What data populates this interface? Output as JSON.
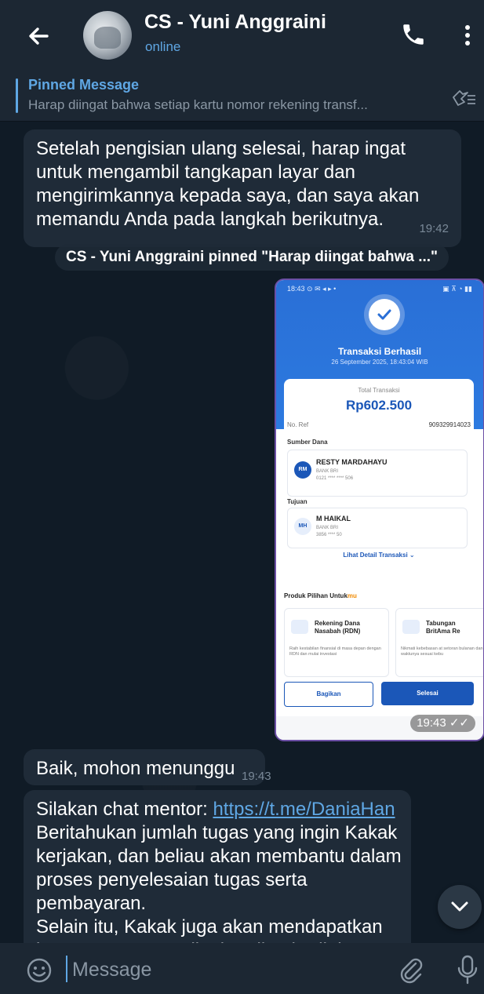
{
  "header": {
    "title": "CS - Yuni Anggraini",
    "status": "online"
  },
  "pinned": {
    "label": "Pinned Message",
    "text": "Harap diingat bahwa setiap kartu nomor rekening transf..."
  },
  "messages": {
    "m1": {
      "text": "Setelah pengisian ulang selesai, harap ingat untuk mengambil tangkapan layar dan mengirimkannya kepada saya, dan saya akan memandu Anda pada langkah berikutnya.",
      "time": "19:42"
    },
    "service": "CS - Yuni Anggraini pinned \"Harap diingat bahwa ...\"",
    "photo": {
      "time": "19:43",
      "receipt": {
        "title": "Transaksi Berhasil",
        "date": "26 September 2025, 18:43:04 WIB",
        "total_label": "Total Transaksi",
        "total": "Rp602.500",
        "ref_label": "No. Ref",
        "ref_value": "909329914023",
        "source_label": "Sumber Dana",
        "source_initials": "RM",
        "source_name": "RESTY MARDAHAYU",
        "source_bank": "BANK BRI",
        "source_account": "0121 **** **** 506",
        "dest_label": "Tujuan",
        "dest_initials": "MH",
        "dest_name": "M HAIKAL",
        "dest_bank": "BANK BRI",
        "dest_account": "3856 **** 50",
        "detail_link": "Lihat Detail Transaksi ⌄",
        "products_label": "Produk Pilihan Untuk",
        "products_label_accent": "mu",
        "product1_name": "Rekening Dana Nasabah (RDN)",
        "product1_desc": "Raih kestabilan finansial di masa depan dengan RDN dan mulai investasi",
        "product2_name": "Tabungan BritAma Re",
        "product2_desc": "Nikmati kebebasan at setoran bulanan dan j waktunya sesuai kebu",
        "share_label": "Bagikan",
        "done_label": "Selesai"
      }
    },
    "m2": {
      "text": "Baik, mohon menunggu",
      "time": "19:43"
    },
    "m3": {
      "prefix": "Silakan chat mentor: ",
      "link": "https://t.me/DaniaHan",
      "rest": "Beritahukan jumlah tugas yang ingin Kakak kerjakan, dan beliau akan membantu dalam proses penyelesaian tugas serta pembayaran.",
      "rest2": "Selain itu, Kakak juga akan mendapatkan kesempatan mengikuti undian hadiah"
    }
  },
  "input": {
    "placeholder": "Message"
  },
  "colors": {
    "accent": "#5fa7e4",
    "bubble": "#1f2b38",
    "bar": "#1c2733"
  },
  "icons": [
    "arrow-left-icon",
    "phone-icon",
    "more-vert-icon",
    "unpin-icon",
    "chevron-down-icon",
    "emoji-icon",
    "paperclip-icon",
    "microphone-icon"
  ]
}
